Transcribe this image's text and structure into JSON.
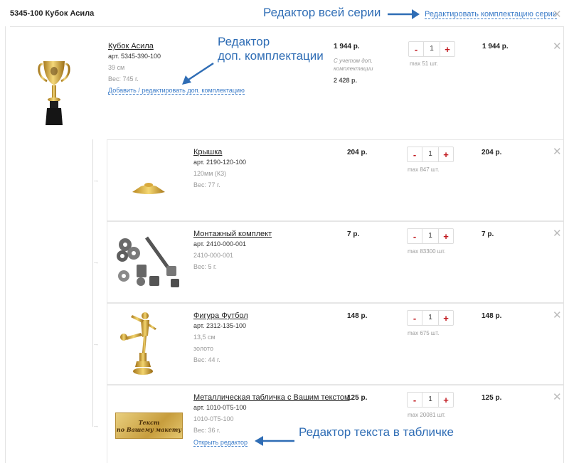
{
  "header": {
    "series_title": "5345-100 Кубок Асила",
    "annotation": "Редактор всей серии",
    "edit_series_link": "Редактировать комплектацию серии"
  },
  "main": {
    "name": "Кубок Асила",
    "art": "арт. 5345-390-100",
    "size": "39 см",
    "weight": "Вес: 745 г.",
    "edit_link": "Добавить / редактировать доп. комплектацию",
    "price": "1 944 р.",
    "price_note": "С учетом доп. комплектации",
    "price_with_extras": "2 428 р.",
    "qty": "1",
    "max": "max 51 шт.",
    "total": "1 944 р.",
    "annotation_line1": "Редактор",
    "annotation_line2": "доп. комплектации"
  },
  "items": [
    {
      "name": "Крышка",
      "art": "арт. 2190-120-100",
      "meta1": "120мм (К3)",
      "meta2": "Вес: 77 г.",
      "price": "204 р.",
      "qty": "1",
      "max": "max 847 шт.",
      "total": "204 р."
    },
    {
      "name": "Монтажный комплект",
      "art": "арт. 2410-000-001",
      "meta1": "2410-000-001",
      "meta2": "Вес: 5 г.",
      "price": "7 р.",
      "qty": "1",
      "max": "max 83300 шт.",
      "total": "7 р."
    },
    {
      "name": "Фигура Футбол",
      "art": "арт. 2312-135-100",
      "meta1": "13,5 см",
      "meta2": "золото",
      "meta3": "Вес: 44 г.",
      "price": "148 р.",
      "qty": "1",
      "max": "max 675 шт.",
      "total": "148 р."
    },
    {
      "name": "Металлическая табличка с Вашим текстом",
      "art": "арт. 1010-0Т5-100",
      "meta1": "1010-0Т5-100",
      "meta2": "Вес: 36 г.",
      "link": "Открыть редактор",
      "price": "125 р.",
      "qty": "1",
      "max": "max 20081 шт.",
      "total": "125 р.",
      "plate_line1": "Текст",
      "plate_line2": "по Вашему макету",
      "annotation": "Редактор текста в табличке"
    }
  ],
  "controls": {
    "minus": "-",
    "plus": "+",
    "close": "✕"
  },
  "colors": {
    "accent_red": "#c1191f",
    "link_blue": "#3a7bc8",
    "annotation_blue": "#2f6db5"
  }
}
